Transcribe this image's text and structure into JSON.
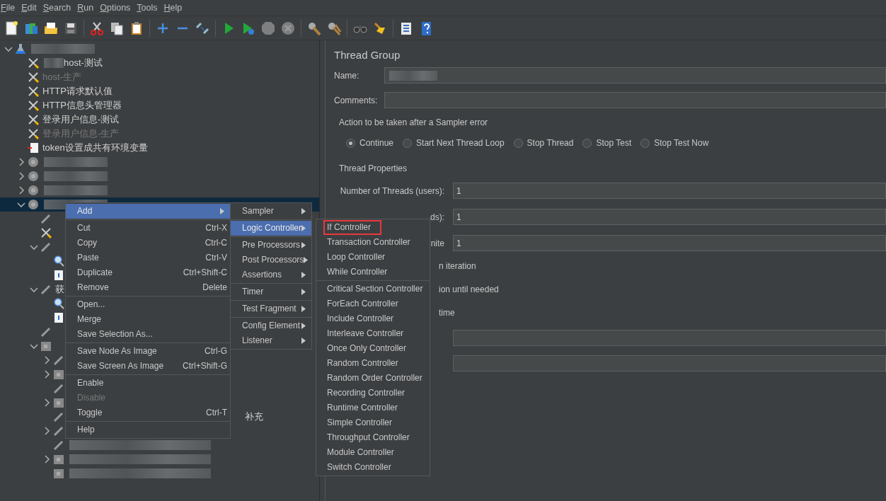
{
  "menu_bar": [
    {
      "label": "File"
    },
    {
      "label": "Edit"
    },
    {
      "label": "Search"
    },
    {
      "label": "Run"
    },
    {
      "label": "Options"
    },
    {
      "label": "Tools"
    },
    {
      "label": "Help"
    }
  ],
  "toolbar": [
    {
      "kind": "new",
      "disabled": false
    },
    {
      "kind": "templates",
      "disabled": false
    },
    {
      "kind": "open",
      "disabled": false
    },
    {
      "kind": "save",
      "disabled": false
    },
    {
      "kind": "sep"
    },
    {
      "kind": "cut",
      "disabled": false
    },
    {
      "kind": "copy",
      "disabled": false
    },
    {
      "kind": "paste",
      "disabled": false
    },
    {
      "kind": "sep"
    },
    {
      "kind": "expand",
      "disabled": false
    },
    {
      "kind": "collapse",
      "disabled": false
    },
    {
      "kind": "toggle",
      "disabled": false
    },
    {
      "kind": "sep"
    },
    {
      "kind": "start",
      "disabled": false
    },
    {
      "kind": "start-no-timers",
      "disabled": false
    },
    {
      "kind": "stop",
      "disabled": true
    },
    {
      "kind": "shutdown",
      "disabled": true
    },
    {
      "kind": "sep"
    },
    {
      "kind": "clear",
      "disabled": false
    },
    {
      "kind": "clear-all",
      "disabled": false
    },
    {
      "kind": "sep"
    },
    {
      "kind": "search",
      "disabled": false
    },
    {
      "kind": "reset-search",
      "disabled": false
    },
    {
      "kind": "sep"
    },
    {
      "kind": "function-helper",
      "disabled": false
    },
    {
      "kind": "help",
      "disabled": false
    }
  ],
  "tree": [
    {
      "kind": "flask",
      "redacted": true,
      "expanded": true,
      "selected": false,
      "children": [
        {
          "kind": "wrench",
          "label": "host-测试",
          "redacted": true,
          "disabled": false,
          "selected": false
        },
        {
          "kind": "wrench",
          "label": "host-生产",
          "disabled": true,
          "selected": false
        },
        {
          "kind": "wrench",
          "label": "HTTP请求默认值",
          "disabled": false,
          "selected": false
        },
        {
          "kind": "wrench",
          "label": "HTTP信息头管理器",
          "disabled": false,
          "selected": false
        },
        {
          "kind": "wrench",
          "label": "登录用户信息-测试",
          "disabled": false,
          "selected": false
        },
        {
          "kind": "wrench",
          "label": "登录用户信息-生产",
          "disabled": true,
          "selected": false
        },
        {
          "kind": "script",
          "label": "token设置成共有环境变量",
          "disabled": false,
          "selected": false
        },
        {
          "kind": "gear",
          "redacted": true,
          "expanded": false,
          "selected": false
        },
        {
          "kind": "gear",
          "redacted": true,
          "expanded": false,
          "selected": false
        },
        {
          "kind": "gear",
          "redacted": true,
          "expanded": false,
          "selected": false
        },
        {
          "kind": "gear",
          "redacted": true,
          "expanded": true,
          "selected": true,
          "children": [
            {
              "kind": "pencil",
              "selected": false
            },
            {
              "kind": "wrench",
              "selected": false
            },
            {
              "kind": "pencil",
              "expanded": true,
              "selected": false,
              "children": [
                {
                  "kind": "magnifier",
                  "selected": false
                },
                {
                  "kind": "doc",
                  "selected": false
                }
              ]
            },
            {
              "kind": "pencil",
              "label": "获",
              "expanded": true,
              "selected": false,
              "children": [
                {
                  "kind": "magnifier",
                  "selected": false
                },
                {
                  "kind": "doc",
                  "selected": false
                }
              ]
            },
            {
              "kind": "pencil",
              "selected": false
            },
            {
              "kind": "box",
              "expanded": true,
              "selected": false,
              "children": [
                {
                  "kind": "pencil",
                  "expanded": false,
                  "selected": false
                },
                {
                  "kind": "box",
                  "expanded": false,
                  "selected": false
                },
                {
                  "kind": "pencil",
                  "selected": false
                },
                {
                  "kind": "box",
                  "expanded": false,
                  "selected": false
                },
                {
                  "kind": "pencil",
                  "label": "补充",
                  "selected": false
                },
                {
                  "kind": "pencil",
                  "expanded": false,
                  "selected": false
                },
                {
                  "kind": "pencil",
                  "redacted": true,
                  "selected": false
                },
                {
                  "kind": "box",
                  "redacted": true,
                  "expanded": false,
                  "selected": false
                },
                {
                  "kind": "box",
                  "redacted": true,
                  "selected": false
                }
              ]
            }
          ]
        }
      ]
    }
  ],
  "panel": {
    "title": "Thread Group",
    "name_label": "Name:",
    "name_redacted": true,
    "comments_label": "Comments:",
    "error_group": {
      "legend": "Action to be taken after a Sampler error",
      "options": [
        {
          "label": "Continue",
          "selected": true
        },
        {
          "label": "Start Next Thread Loop",
          "selected": false
        },
        {
          "label": "Stop Thread",
          "selected": false
        },
        {
          "label": "Stop Test",
          "selected": false
        },
        {
          "label": "Stop Test Now",
          "selected": false
        }
      ]
    },
    "properties": {
      "legend": "Thread Properties",
      "fields": [
        {
          "label": "Number of Threads (users):",
          "value": "1"
        },
        {
          "label": "ds):",
          "value": "1"
        },
        {
          "label": "nite",
          "value": "1"
        }
      ],
      "options": [
        {
          "label": "n iteration"
        },
        {
          "label": "ion until needed"
        },
        {
          "label": "time"
        }
      ],
      "extra_fields": [
        {
          "kind": "text"
        },
        {
          "kind": "text"
        }
      ]
    }
  },
  "context_menu": {
    "groups": [
      [
        {
          "label": "Add",
          "selected": true,
          "submenu": true,
          "disabled": false
        }
      ],
      [
        {
          "label": "Cut",
          "shortcut": "Ctrl-X",
          "selected": false,
          "disabled": false
        },
        {
          "label": "Copy",
          "shortcut": "Ctrl-C",
          "selected": false,
          "disabled": false
        },
        {
          "label": "Paste",
          "shortcut": "Ctrl-V",
          "selected": false,
          "disabled": false
        },
        {
          "label": "Duplicate",
          "shortcut": "Ctrl+Shift-C",
          "selected": false,
          "disabled": false
        },
        {
          "label": "Remove",
          "shortcut": "Delete",
          "selected": false,
          "disabled": false
        }
      ],
      [
        {
          "label": "Open...",
          "selected": false,
          "disabled": false
        },
        {
          "label": "Merge",
          "selected": false,
          "disabled": false
        },
        {
          "label": "Save Selection As...",
          "selected": false,
          "disabled": false
        }
      ],
      [
        {
          "label": "Save Node As Image",
          "shortcut": "Ctrl-G",
          "selected": false,
          "disabled": false
        },
        {
          "label": "Save Screen As Image",
          "shortcut": "Ctrl+Shift-G",
          "selected": false,
          "disabled": false
        }
      ],
      [
        {
          "label": "Enable",
          "selected": false,
          "disabled": false
        },
        {
          "label": "Disable",
          "selected": false,
          "disabled": true
        },
        {
          "label": "Toggle",
          "shortcut": "Ctrl-T",
          "selected": false,
          "disabled": false
        }
      ],
      [
        {
          "label": "Help",
          "selected": false,
          "disabled": false
        }
      ]
    ]
  },
  "add_submenu": {
    "groups": [
      [
        {
          "label": "Sampler",
          "selected": false,
          "submenu": true
        }
      ],
      [
        {
          "label": "Logic Controller",
          "selected": true,
          "submenu": true
        }
      ],
      [
        {
          "label": "Pre Processors",
          "selected": false,
          "submenu": true
        },
        {
          "label": "Post Processors",
          "selected": false,
          "submenu": true
        },
        {
          "label": "Assertions",
          "selected": false,
          "submenu": true
        }
      ],
      [
        {
          "label": "Timer",
          "selected": false,
          "submenu": true
        }
      ],
      [
        {
          "label": "Test Fragment",
          "selected": false,
          "submenu": true
        }
      ],
      [
        {
          "label": "Config Element",
          "selected": false,
          "submenu": true
        },
        {
          "label": "Listener",
          "selected": false,
          "submenu": true
        }
      ]
    ]
  },
  "logic_controller_submenu": {
    "groups": [
      [
        {
          "label": "If Controller",
          "highlighted": true
        },
        {
          "label": "Transaction Controller",
          "highlighted": false
        },
        {
          "label": "Loop Controller",
          "highlighted": false
        },
        {
          "label": "While Controller",
          "highlighted": false
        }
      ],
      [
        {
          "label": "Critical Section Controller",
          "highlighted": false
        },
        {
          "label": "ForEach Controller",
          "highlighted": false
        },
        {
          "label": "Include Controller",
          "highlighted": false
        },
        {
          "label": "Interleave Controller",
          "highlighted": false
        },
        {
          "label": "Once Only Controller",
          "highlighted": false
        },
        {
          "label": "Random Controller",
          "highlighted": false
        },
        {
          "label": "Random Order Controller",
          "highlighted": false
        },
        {
          "label": "Recording Controller",
          "highlighted": false
        },
        {
          "label": "Runtime Controller",
          "highlighted": false
        },
        {
          "label": "Simple Controller",
          "highlighted": false
        },
        {
          "label": "Throughput Controller",
          "highlighted": false
        },
        {
          "label": "Module Controller",
          "highlighted": false
        },
        {
          "label": "Switch Controller",
          "highlighted": false
        }
      ]
    ]
  }
}
